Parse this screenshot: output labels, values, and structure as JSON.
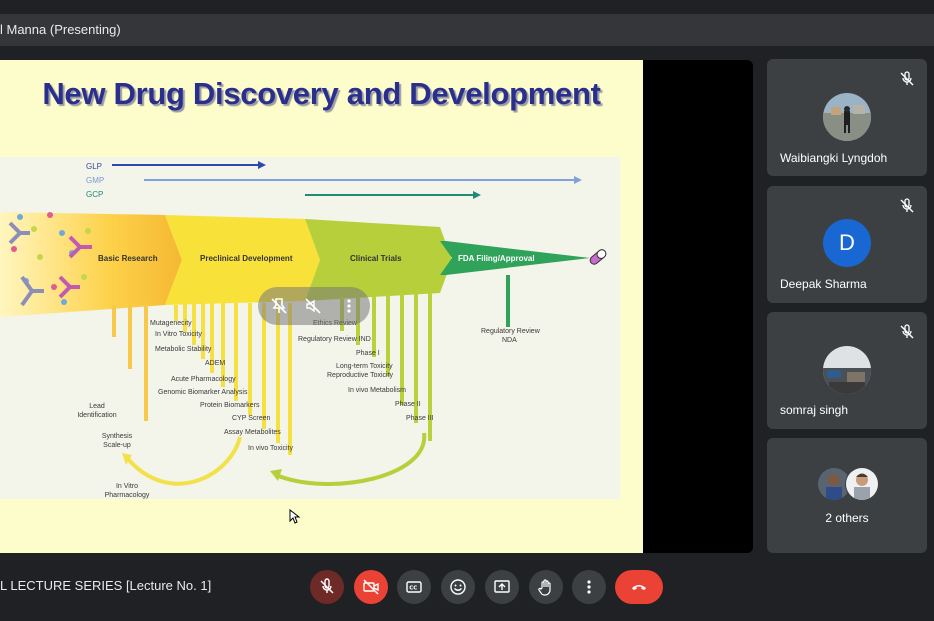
{
  "presenter": {
    "label": "l Manna (Presenting)"
  },
  "slide": {
    "title": "New Drug Discovery and Development",
    "guidelines": [
      "GLP",
      "GMP",
      "GCP"
    ],
    "stages": [
      "Basic Research",
      "Preclinical Development",
      "Clinical Trials",
      "FDA Filing/Approval"
    ],
    "basic_items": [
      "Lead\nIdentification",
      "Synthesis\nScale-up",
      "In Vitro\nPharmacology"
    ],
    "preclinical_items": [
      "Mutagenecity",
      "In Vitro Toxicity",
      "Metabolic Stability",
      "ADEM",
      "Acute Pharmacology",
      "Genomic Biomarker Analysis",
      "Protein Biomarkers",
      "CYP Screen",
      "Assay Metabolites",
      "In vivo Toxicity"
    ],
    "clinical_items": [
      "Ethics Review",
      "Regulatory Review IND",
      "Phase I",
      "Long-term Toxicity",
      "Reproductive Toxicity",
      "In vivo Metabolism",
      "Phase II",
      "Phase III"
    ],
    "fda_items": [
      "Regulatory Review",
      "NDA"
    ]
  },
  "participants": [
    {
      "name": "Waibiangki Lyngdoh",
      "muted": true,
      "avatar": "photo"
    },
    {
      "name": "Deepak Sharma",
      "muted": true,
      "avatar_letter": "D",
      "avatar_color": "#1967d2"
    },
    {
      "name": "somraj singh",
      "muted": true,
      "avatar": "photo"
    }
  ],
  "others": {
    "label": "2 others"
  },
  "meeting": {
    "title": "L LECTURE SERIES [Lecture No. 1]"
  },
  "controls": [
    {
      "name": "mic-off-icon",
      "state": "off"
    },
    {
      "name": "camera-off-icon",
      "state": "off"
    },
    {
      "name": "captions-icon"
    },
    {
      "name": "emoji-icon"
    },
    {
      "name": "present-screen-icon"
    },
    {
      "name": "raise-hand-icon"
    },
    {
      "name": "more-options-icon"
    },
    {
      "name": "end-call-icon"
    }
  ],
  "colors": {
    "accent_red": "#ea4335",
    "avatar_blue": "#1967d2",
    "tile_bg": "#3c4043",
    "page_bg": "#202124"
  }
}
